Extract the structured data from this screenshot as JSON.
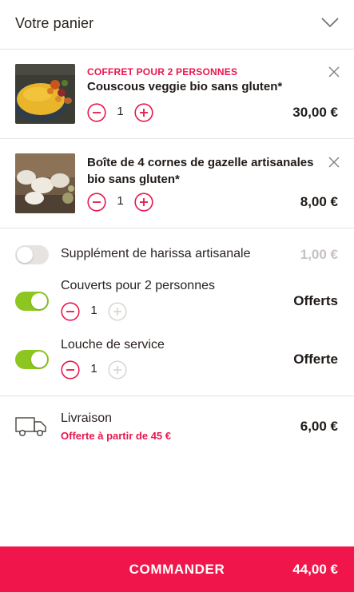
{
  "header": {
    "title": "Votre panier",
    "toggle_icon": "chevron-down-icon"
  },
  "items": [
    {
      "tag": "COFFRET POUR 2 PERSONNES",
      "name": "Couscous veggie bio sans gluten*",
      "quantity": "1",
      "price": "30,00 €"
    },
    {
      "tag": "",
      "name": "Boîte de 4 cornes de gazelle artisanales bio sans gluten*",
      "quantity": "1",
      "price": "8,00 €"
    }
  ],
  "extras": [
    {
      "label": "Supplément de harissa artisanale",
      "enabled": false,
      "price": "1,00 €"
    },
    {
      "label": "Couverts pour 2 personnes",
      "enabled": true,
      "quantity": "1",
      "price": "Offerts"
    },
    {
      "label": "Louche de service",
      "enabled": true,
      "quantity": "1",
      "price": "Offerte"
    }
  ],
  "delivery": {
    "label": "Livraison",
    "note": "Offerte à partir de 45 €",
    "price": "6,00 €",
    "icon": "truck-icon"
  },
  "order": {
    "label": "COMMANDER",
    "total": "44,00 €"
  },
  "colors": {
    "accent": "#f0154a",
    "accent_text": "#e8174d",
    "toggle_on": "#8dc620",
    "toggle_off": "#e6e3e1",
    "muted": "#c7c2bf"
  }
}
